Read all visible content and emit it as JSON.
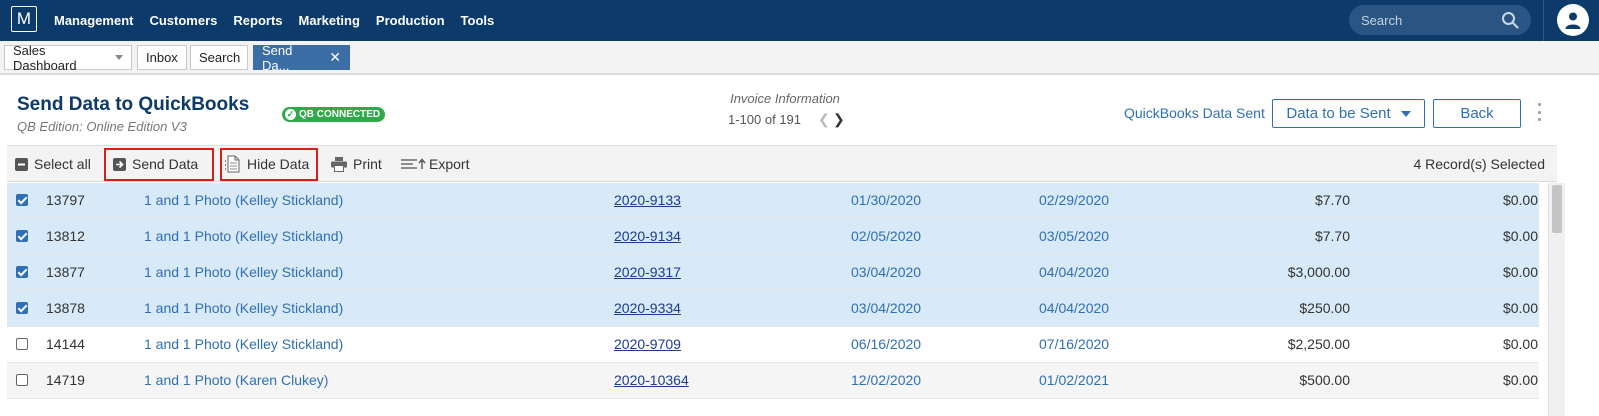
{
  "nav": {
    "logo": "M",
    "items": [
      "Management",
      "Customers",
      "Reports",
      "Marketing",
      "Production",
      "Tools"
    ],
    "search_placeholder": "Search"
  },
  "tabs": [
    {
      "label": "Sales Dashboard"
    },
    {
      "label": "Inbox"
    },
    {
      "label": "Search"
    },
    {
      "label": "Send Da..."
    }
  ],
  "header": {
    "title": "Send Data to QuickBooks",
    "badge": "QB CONNECTED",
    "edition": "QB Edition: Online Edition V3",
    "info_title": "Invoice Information",
    "range": "1-100 of 191",
    "qb_sent_link": "QuickBooks Data Sent",
    "dropdown_label": "Data to be Sent",
    "back_label": "Back"
  },
  "toolbar": {
    "select_all": "Select all",
    "send_data": "Send Data",
    "hide_data": "Hide Data",
    "print": "Print",
    "export": "Export",
    "records_selected": "4 Record(s) Selected"
  },
  "rows": [
    {
      "checked": true,
      "id": "13797",
      "customer": "1 and 1 Photo (Kelley Stickland)",
      "invoice": "2020-9133",
      "date1": "01/30/2020",
      "date2": "02/29/2020",
      "amount": "$7.70",
      "balance": "$0.00"
    },
    {
      "checked": true,
      "id": "13812",
      "customer": "1 and 1 Photo (Kelley Stickland)",
      "invoice": "2020-9134",
      "date1": "02/05/2020",
      "date2": "03/05/2020",
      "amount": "$7.70",
      "balance": "$0.00"
    },
    {
      "checked": true,
      "id": "13877",
      "customer": "1 and 1 Photo (Kelley Stickland)",
      "invoice": "2020-9317",
      "date1": "03/04/2020",
      "date2": "04/04/2020",
      "amount": "$3,000.00",
      "balance": "$0.00"
    },
    {
      "checked": true,
      "id": "13878",
      "customer": "1 and 1 Photo (Kelley Stickland)",
      "invoice": "2020-9334",
      "date1": "03/04/2020",
      "date2": "04/04/2020",
      "amount": "$250.00",
      "balance": "$0.00"
    },
    {
      "checked": false,
      "id": "14144",
      "customer": "1 and 1 Photo (Kelley Stickland)",
      "invoice": "2020-9709",
      "date1": "06/16/2020",
      "date2": "07/16/2020",
      "amount": "$2,250.00",
      "balance": "$0.00"
    },
    {
      "checked": false,
      "id": "14719",
      "customer": "1 and 1 Photo (Karen Clukey)",
      "invoice": "2020-10364",
      "date1": "12/02/2020",
      "date2": "01/02/2021",
      "amount": "$500.00",
      "balance": "$0.00"
    }
  ],
  "colors": {
    "nav_bg": "#0b3a6b",
    "accent": "#2f6fb5",
    "selected_row": "#d8e9f7",
    "badge_green": "#2eaa4a",
    "highlight_red": "#e01b1b"
  }
}
